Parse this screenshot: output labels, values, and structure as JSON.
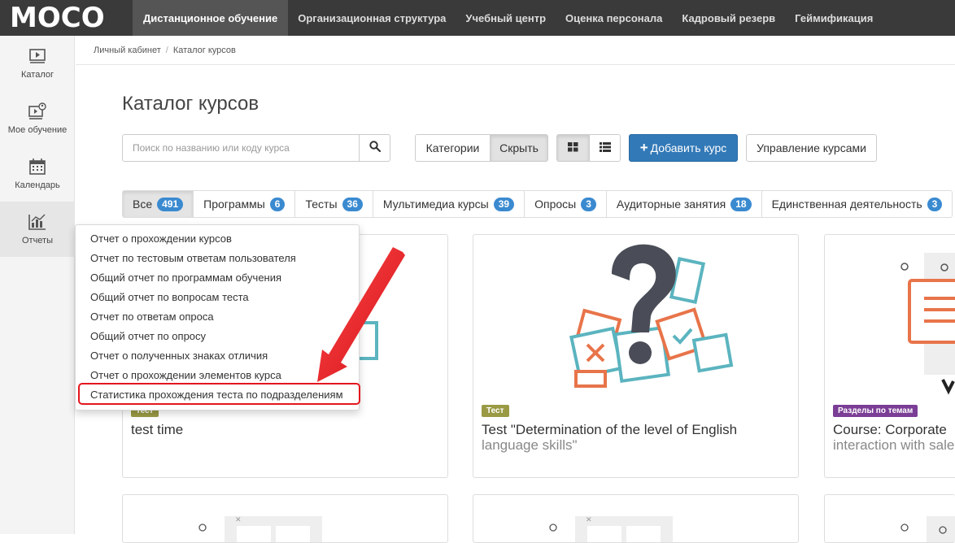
{
  "brand": {
    "logo_text": "MOCO"
  },
  "topnav": [
    {
      "label": "Дистанционное обучение",
      "active": true
    },
    {
      "label": "Организационная структура"
    },
    {
      "label": "Учебный центр"
    },
    {
      "label": "Оценка персонала"
    },
    {
      "label": "Кадровый резерв"
    },
    {
      "label": "Геймификация"
    }
  ],
  "sidebar": [
    {
      "label": "Каталог",
      "icon": "catalog-icon"
    },
    {
      "label": "Мое обучение",
      "icon": "my-learning-icon"
    },
    {
      "label": "Календарь",
      "icon": "calendar-icon"
    },
    {
      "label": "Отчеты",
      "icon": "reports-icon",
      "active": true
    }
  ],
  "breadcrumb": {
    "home": "Личный кабинет",
    "separator": "/",
    "current": "Каталог курсов"
  },
  "page_title": "Каталог курсов",
  "search": {
    "placeholder": "Поиск по названию или коду курса"
  },
  "toolbar": {
    "categories_label": "Категории",
    "hide_label": "Скрыть",
    "add_course_label": "Добавить курс",
    "manage_courses_label": "Управление курсами"
  },
  "tabs": [
    {
      "label": "Все",
      "count": "491",
      "active": true
    },
    {
      "label": "Программы",
      "count": "6"
    },
    {
      "label": "Тесты",
      "count": "36"
    },
    {
      "label": "Мультимедиа курсы",
      "count": "39"
    },
    {
      "label": "Опросы",
      "count": "3"
    },
    {
      "label": "Аудиторные занятия",
      "count": "18"
    },
    {
      "label": "Единственная деятельность",
      "count": "3"
    }
  ],
  "cards": [
    {
      "tag": "Тест",
      "title": "test time",
      "title_rest": ""
    },
    {
      "tag": "Тест",
      "title": "Test \"Determination of the level of English",
      "title_rest": "language skills\""
    },
    {
      "tag": "Разделы по темам",
      "title": "Course: Corporate",
      "title_rest": "interaction with sale"
    }
  ],
  "reports_menu": [
    "Отчет о прохождении курсов",
    "Отчет по тестовым ответам пользователя",
    "Общий отчет по программам обучения",
    "Общий отчет по вопросам теста",
    "Отчет по ответам опроса",
    "Общий отчет по опросу",
    "Отчет о полученных знаках отличия",
    "Отчет о прохождении элементов курса",
    "Статистика прохождения теста по подразделениям"
  ],
  "colors": {
    "topbar": "#3a3a3a",
    "primary": "#3279b7",
    "badge": "#3a8ad0",
    "tag_test": "#9a9a44",
    "tag_topics": "#7b3e96",
    "highlight": "#e3161d",
    "illus_orange": "#e8744a",
    "illus_teal": "#5bb4bf",
    "illus_dark": "#4a4d57"
  }
}
